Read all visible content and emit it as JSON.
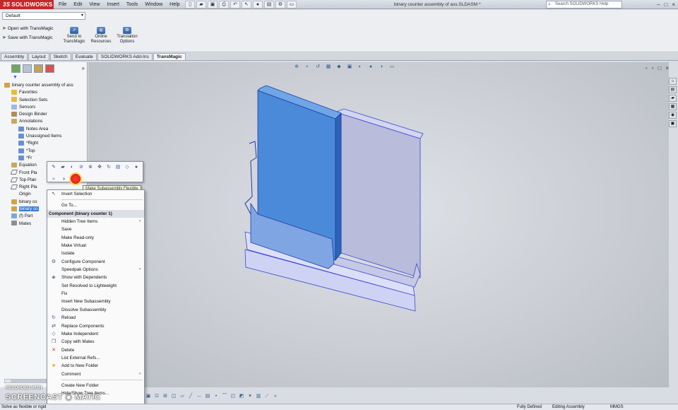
{
  "app": {
    "brand": "SOLIDWORKS",
    "brand_prefix": "3S",
    "menus": [
      "File",
      "Edit",
      "View",
      "Insert",
      "Tools",
      "Window",
      "Help"
    ],
    "doc_title": "binary counter assembly of ass.SLDASM *",
    "search_placeholder": "Search SOLIDWORKS Help",
    "win_min": "–",
    "win_max": "□",
    "win_close": "×"
  },
  "config": {
    "selected": "Default"
  },
  "ribbon": {
    "open_label": "Open with TransMagic",
    "save_label": "Save with TransMagic",
    "send_label": "Send to TransMagic",
    "online_label": "Online Resources",
    "translation_label": "Translation Options"
  },
  "tabs": [
    {
      "label": "Assembly"
    },
    {
      "label": "Layout"
    },
    {
      "label": "Sketch"
    },
    {
      "label": "Evaluate"
    },
    {
      "label": "SOLIDWORKS Add-Ins"
    },
    {
      "label": "TransMagic"
    }
  ],
  "tree": {
    "items": [
      {
        "label": "binary counter assembly of ass",
        "indent": 0,
        "icon": "ic-asm"
      },
      {
        "label": "Favorites",
        "indent": 2,
        "icon": "ic-folder"
      },
      {
        "label": "Selection Sets",
        "indent": 2,
        "icon": "ic-folder"
      },
      {
        "label": "Sensors",
        "indent": 2,
        "icon": "ic-sensor"
      },
      {
        "label": "Design Binder",
        "indent": 2,
        "icon": "ic-binder"
      },
      {
        "label": "Annotations",
        "indent": 2,
        "icon": "ic-anno"
      },
      {
        "label": "Notes Area",
        "indent": 4,
        "icon": "ic-note"
      },
      {
        "label": "Unassigned Items",
        "indent": 4,
        "icon": "ic-note"
      },
      {
        "label": "*Right",
        "indent": 4,
        "icon": "ic-note"
      },
      {
        "label": "*Top",
        "indent": 4,
        "icon": "ic-note"
      },
      {
        "label": "*Fr",
        "indent": 4,
        "icon": "ic-note"
      },
      {
        "label": "Equation",
        "indent": 2,
        "icon": "ic-anno"
      },
      {
        "label": "Front Pla",
        "indent": 2,
        "icon": "ic-plane"
      },
      {
        "label": "Top Plan",
        "indent": 2,
        "icon": "ic-plane"
      },
      {
        "label": "Right Pla",
        "indent": 2,
        "icon": "ic-plane"
      },
      {
        "label": "Origin",
        "indent": 2,
        "icon": "ic-origin"
      },
      {
        "label": "binary co",
        "indent": 2,
        "icon": "ic-asm"
      },
      {
        "label": "binary co",
        "indent": 2,
        "icon": "ic-asm",
        "selected": true
      },
      {
        "label": "(f) Part",
        "indent": 2,
        "icon": "ic-part"
      },
      {
        "label": "Mates",
        "indent": 2,
        "icon": "ic-mate"
      }
    ]
  },
  "context_tooltip": "Make Subassembly Flexible",
  "context_menu": {
    "items": [
      {
        "label": "Invert Selection",
        "icon": "↖"
      },
      {
        "sep": true
      },
      {
        "label": "Go To..."
      },
      {
        "label": "Component (binary counter 1)",
        "header": true
      },
      {
        "label": "Hidden Tree Items",
        "sub": true
      },
      {
        "label": "Save"
      },
      {
        "label": "Make Read-only"
      },
      {
        "label": "Make Virtual"
      },
      {
        "label": "Isolate"
      },
      {
        "label": "Configure Component",
        "icon": "⚙"
      },
      {
        "label": "Speedpak Options",
        "sub": true
      },
      {
        "label": "Show with Dependents",
        "icon": "◈"
      },
      {
        "label": "Set Resolved to Lightweight"
      },
      {
        "label": "Fix"
      },
      {
        "label": "Insert New Subassembly"
      },
      {
        "label": "Dissolve Subassembly"
      },
      {
        "label": "Reload",
        "icon": "↻"
      },
      {
        "label": "Replace Components",
        "icon": "⇄"
      },
      {
        "label": "Make Independent",
        "icon": "◇"
      },
      {
        "label": "Copy with Mates",
        "icon": "❐"
      },
      {
        "label": "Delete",
        "icon": "✕",
        "icon_color": "#d32f2f"
      },
      {
        "label": "List External Refs..."
      },
      {
        "label": "Add to New Folder",
        "icon": "■",
        "icon_color": "#e8b93a"
      },
      {
        "label": "Comment",
        "sub": true
      },
      {
        "sep": true
      },
      {
        "label": "Create New Folder"
      },
      {
        "label": "Hide/Show Tree Items..."
      }
    ]
  },
  "watermark": {
    "top": "RECORDED WITH",
    "main": "SCREENCAST ◉ MATIC"
  },
  "status": {
    "left": "Solve as flexible or rigid",
    "defined": "Fully Defined",
    "editing": "Editing Assembly",
    "units": "MMGS"
  }
}
